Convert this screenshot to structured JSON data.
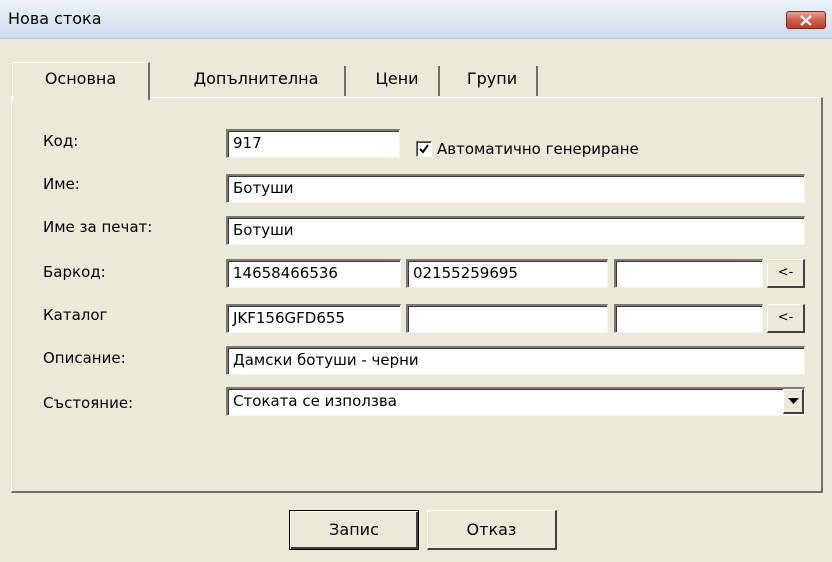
{
  "window": {
    "title": "Нова стока"
  },
  "tabs": [
    {
      "label": "Основна",
      "active": true
    },
    {
      "label": "Допълнителна",
      "active": false
    },
    {
      "label": "Цени",
      "active": false
    },
    {
      "label": "Групи",
      "active": false
    }
  ],
  "form": {
    "code": {
      "label": "Код:",
      "value": "917"
    },
    "auto_generate": {
      "label": "Автоматично генериране",
      "checked": true
    },
    "name": {
      "label": "Име:",
      "value": "Ботуши"
    },
    "print_name": {
      "label": "Име за печат:",
      "value": "Ботуши"
    },
    "barcode": {
      "label": "Баркод:",
      "values": [
        "14658466536",
        "02155259695",
        ""
      ],
      "button_label": "<-"
    },
    "catalog": {
      "label": "Каталог",
      "values": [
        "JKF156GFD655",
        "",
        ""
      ],
      "button_label": "<-"
    },
    "description": {
      "label": "Описание:",
      "value": "Дамски ботуши - черни"
    },
    "status": {
      "label": "Състояние:",
      "value": "Стоката се използва"
    }
  },
  "buttons": {
    "save": "Запис",
    "cancel": "Отказ"
  },
  "colors": {
    "dialog_background": "#ece9d8",
    "close_button": "#c8503a",
    "field_background": "#ffffff"
  }
}
